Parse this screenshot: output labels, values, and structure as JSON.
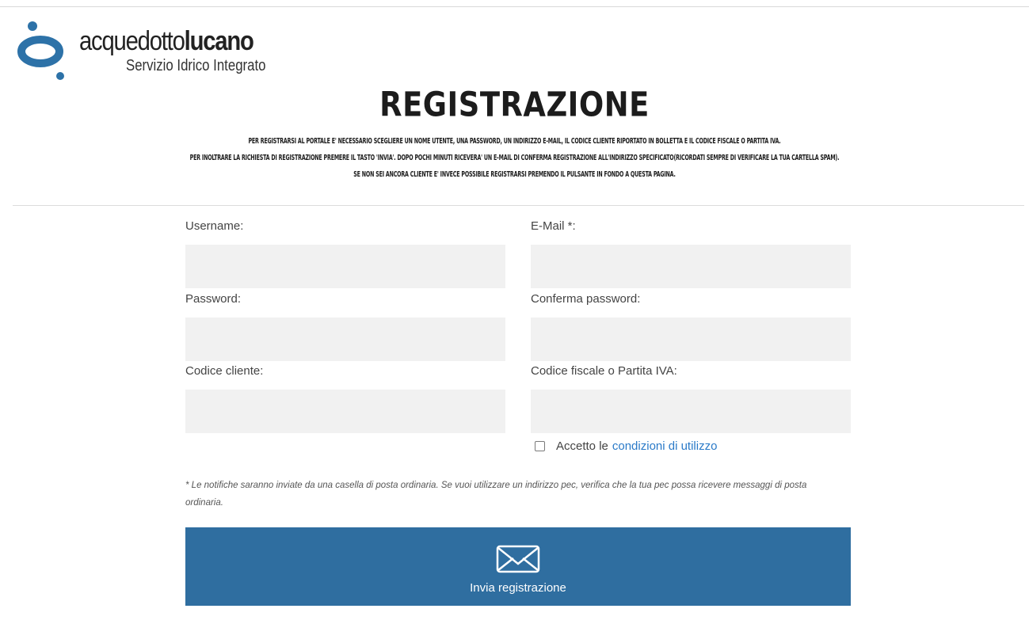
{
  "brand": {
    "name_part1": "acquedotto",
    "name_part2": "lucano",
    "subtitle": "Servizio Idrico Integrato",
    "logo_color": "#2d72a8"
  },
  "page": {
    "title": "REGISTRAZIONE",
    "intro_lines": [
      "PER REGISTRARSI AL PORTALE E' NECESSARIO SCEGLIERE UN NOME UTENTE, UNA PASSWORD, UN INDIRIZZO E-MAIL, IL CODICE CLIENTE RIPORTATO IN BOLLETTA E IL CODICE FISCALE O PARTITA IVA.",
      "PER INOLTRARE LA RICHIESTA DI REGISTRAZIONE PREMERE IL TASTO 'INVIA'. DOPO POCHI MINUTI RICEVERA' UN E-MAIL DI CONFERMA REGISTRAZIONE ALL'INDIRIZZO SPECIFICATO(RICORDATI SEMPRE DI VERIFICARE LA TUA CARTELLA SPAM).",
      "SE NON SEI ANCORA CLIENTE E' INVECE POSSIBILE REGISTRARSI PREMENDO IL PULSANTE IN FONDO A QUESTA PAGINA."
    ]
  },
  "form": {
    "username": {
      "label": "Username:",
      "value": ""
    },
    "email": {
      "label": "E-Mail *:",
      "value": ""
    },
    "password": {
      "label": "Password:",
      "value": ""
    },
    "confirm_password": {
      "label": "Conferma password:",
      "value": ""
    },
    "customer_code": {
      "label": "Codice cliente:",
      "value": ""
    },
    "tax_code": {
      "label": "Codice fiscale o Partita IVA:",
      "value": ""
    },
    "terms": {
      "label": "Accetto le",
      "link": "condizioni di utilizzo",
      "checked": false
    },
    "note": "* Le notifiche saranno inviate da una casella di posta ordinaria. Se vuoi utilizzare un indirizzo pec, verifica che la tua pec possa ricevere messaggi di posta ordinaria.",
    "submit_label": "Invia registrazione",
    "submit_icon": "envelope-icon",
    "submit_color": "#2f6ea0",
    "link_color": "#2a7ac8"
  }
}
